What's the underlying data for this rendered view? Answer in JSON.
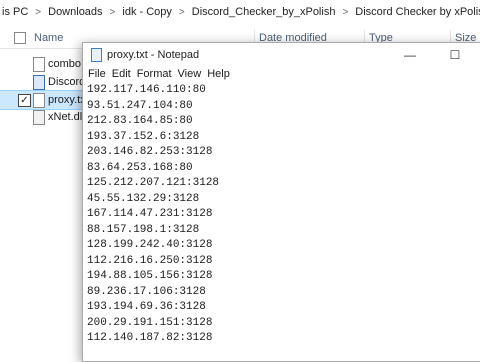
{
  "breadcrumb": [
    "is PC",
    "Downloads",
    "idk - Copy",
    "Discord_Checker_by_xPolish",
    "Discord Checker by xPolish"
  ],
  "columns": {
    "name": "Name",
    "date_modified": "Date modified",
    "type": "Type",
    "size": "Size"
  },
  "files": [
    {
      "name": "combo.txt",
      "icon": "text-file-icon"
    },
    {
      "name": "Discord",
      "icon": "application-icon"
    },
    {
      "name": "proxy.txt",
      "icon": "text-file-icon",
      "selected": true
    },
    {
      "name": "xNet.dll",
      "icon": "dll-file-icon"
    }
  ],
  "notepad": {
    "title": "proxy.txt - Notepad",
    "minimize": "—",
    "maximize": "☐",
    "menu": [
      "File",
      "Edit",
      "Format",
      "View",
      "Help"
    ],
    "lines": [
      "192.117.146.110:80",
      "93.51.247.104:80",
      "212.83.164.85:80",
      "193.37.152.6:3128",
      "203.146.82.253:3128",
      "83.64.253.168:80",
      "125.212.207.121:3128",
      "45.55.132.29:3128",
      "167.114.47.231:3128",
      "88.157.198.1:3128",
      "128.199.242.40:3128",
      "112.216.16.250:3128",
      "194.88.105.156:3128",
      "89.236.17.106:3128",
      "193.194.69.36:3128",
      "200.29.191.151:3128",
      "112.140.187.82:3128"
    ]
  }
}
